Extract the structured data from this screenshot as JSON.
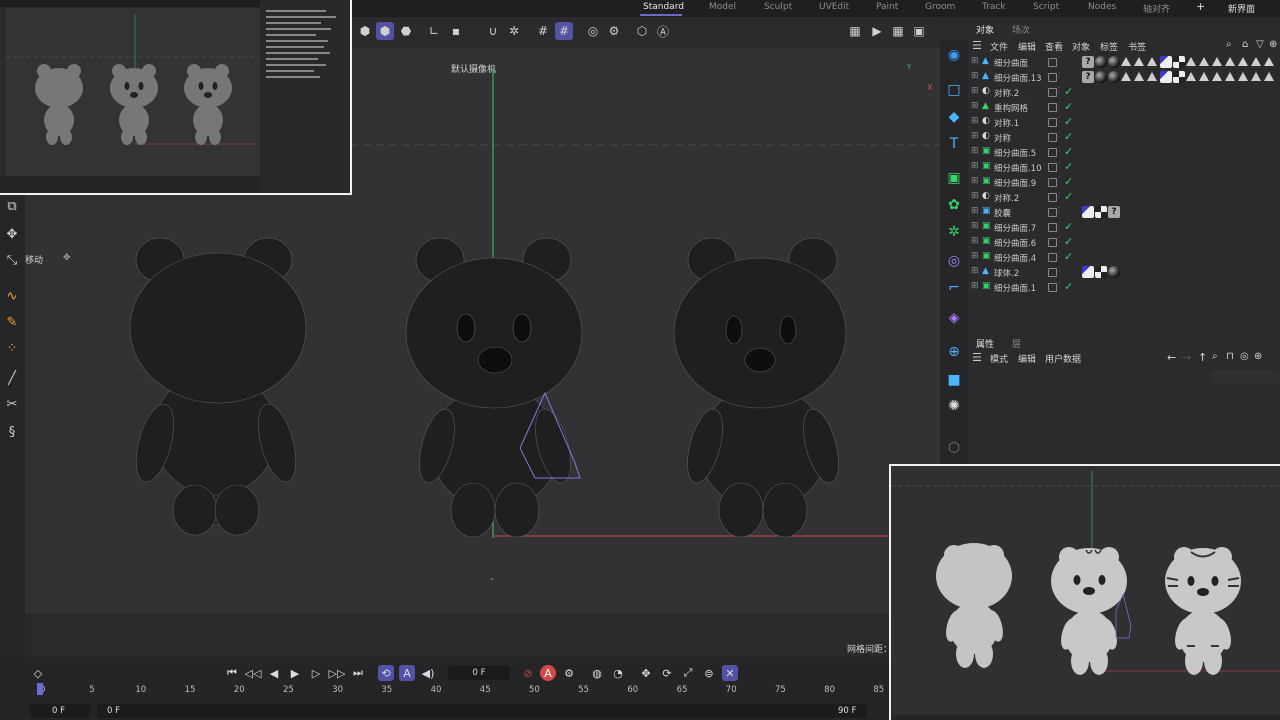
{
  "app": {
    "layouts": [
      "Standard",
      "Model",
      "Sculpt",
      "UVEdit",
      "Paint",
      "Groom",
      "Track",
      "Script",
      "Nodes",
      "轴对齐"
    ],
    "active_layout": "Standard",
    "add_layout": "+",
    "new_layout": "新界面"
  },
  "viewport": {
    "camera_label": "默认摄像机",
    "tool_label": "移动",
    "grid_spacing_label": "网格间距：",
    "axis_y": "Y",
    "axis_x": "X"
  },
  "object_manager": {
    "tabs": [
      "对象",
      "场次"
    ],
    "menu": [
      "文件",
      "编辑",
      "查看",
      "对象",
      "标签",
      "书签"
    ],
    "objects": [
      {
        "name": "细分曲面",
        "indent": 1,
        "icon": "triangle-mesh-icon",
        "tags": [
          "q",
          "sphere",
          "sphere",
          "tri",
          "tri",
          "tri",
          "mat",
          "chk",
          "tri",
          "tri",
          "tri",
          "tri",
          "tri",
          "tri",
          "tri"
        ]
      },
      {
        "name": "细分曲面.13",
        "indent": 1,
        "icon": "triangle-mesh-icon",
        "tags": [
          "q",
          "sphere",
          "sphere",
          "tri",
          "tri",
          "tri",
          "mat",
          "chk",
          "tri",
          "tri",
          "tri",
          "tri",
          "tri",
          "tri",
          "tri"
        ]
      },
      {
        "name": "对称.2",
        "indent": 0,
        "icon": "symmetry-icon",
        "check": true
      },
      {
        "name": "重构网格",
        "indent": 0,
        "icon": "remesh-icon",
        "check": true
      },
      {
        "name": "对称.1",
        "indent": 0,
        "icon": "symmetry-icon",
        "check": true
      },
      {
        "name": "对称",
        "indent": 1,
        "icon": "symmetry-icon",
        "check": true
      },
      {
        "name": "细分曲面.5",
        "indent": 0,
        "icon": "subdivision-icon",
        "check": true
      },
      {
        "name": "细分曲面.10",
        "indent": 0,
        "icon": "subdivision-icon",
        "check": true
      },
      {
        "name": "细分曲面.9",
        "indent": 0,
        "icon": "subdivision-icon",
        "check": true
      },
      {
        "name": "对称.2",
        "indent": 0,
        "icon": "symmetry-icon",
        "check": true
      },
      {
        "name": "胶囊",
        "indent": 1,
        "icon": "capsule-icon",
        "tags": [
          "mat",
          "chk",
          "q"
        ]
      },
      {
        "name": "细分曲面.7",
        "indent": 0,
        "icon": "subdivision-icon",
        "check": true
      },
      {
        "name": "细分曲面.6",
        "indent": 0,
        "icon": "subdivision-icon",
        "check": true
      },
      {
        "name": "细分曲面.4",
        "indent": 0,
        "icon": "subdivision-icon",
        "check": true
      },
      {
        "name": "球体.2",
        "indent": 1,
        "icon": "sphere-icon",
        "tags": [
          "mat",
          "chk",
          "sphere"
        ]
      },
      {
        "name": "细分曲面.1",
        "indent": 0,
        "icon": "subdivision-icon",
        "check": true
      }
    ]
  },
  "attribute_manager": {
    "tabs": [
      "属性",
      "层"
    ],
    "menu": [
      "模式",
      "编辑",
      "用户数据"
    ]
  },
  "timeline": {
    "current_frame": "0 F",
    "start_frame": "0 F",
    "start_frame_2": "0 F",
    "end_frame": "90 F",
    "ruler": [
      "0",
      "5",
      "10",
      "15",
      "20",
      "25",
      "30",
      "35",
      "40",
      "45",
      "50",
      "55",
      "60",
      "65",
      "70",
      "75",
      "80",
      "85"
    ]
  },
  "colors": {
    "accent": "#5353a6",
    "check": "#36d36a",
    "y_axis": "#3ec46a",
    "x_axis": "#d44a4a"
  }
}
